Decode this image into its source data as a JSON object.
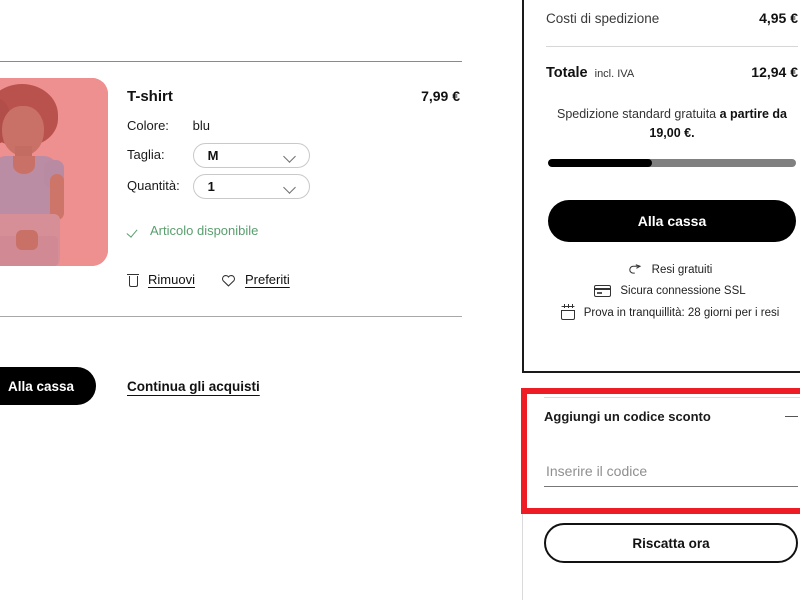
{
  "cart": {
    "product": {
      "image_alt": "model-wearing-blue-tshirt",
      "title": "T-shirt",
      "price": "7,99 €",
      "attributes": [
        {
          "label": "Colore:",
          "value": "blu"
        },
        {
          "label": "Taglia:",
          "value": "M"
        },
        {
          "label": "Quantità:",
          "value": "1"
        }
      ],
      "availability": "Articolo disponibile",
      "availability_color": "#5a9e6f",
      "actions": [
        {
          "icon": "trash-icon",
          "label": "Rimuovi"
        },
        {
          "icon": "heart-icon",
          "label": "Preferiti"
        }
      ]
    },
    "footer": {
      "checkout_label": "Alla cassa",
      "continue_label": "Continua gli acquisti"
    }
  },
  "summary": {
    "shipping_label": "Costi di spedizione",
    "shipping_value": "4,95 €",
    "total_label": "Totale",
    "total_vat_note": "incl. IVA",
    "total_value": "12,94 €",
    "free_shipping_prefix": "Spedizione standard gratuita ",
    "free_shipping_bold": "a partire da 19,00 €.",
    "progress_percent": 42,
    "checkout_button": "Alla cassa",
    "trust_badges": [
      {
        "icon": "return-arrow-icon",
        "label": "Resi gratuiti"
      },
      {
        "icon": "credit-card-icon",
        "label": "Sicura connessione SSL"
      },
      {
        "icon": "calendar-icon",
        "label": "Prova in tranquillità: 28 giorni per i resi"
      }
    ]
  },
  "discount": {
    "header_label": "Aggiungi un codice sconto",
    "toggle_icon": "minus-icon",
    "input_placeholder": "Inserire il codice",
    "input_value": "",
    "redeem_button": "Riscatta ora",
    "highlight_color": "#ee1c25"
  }
}
